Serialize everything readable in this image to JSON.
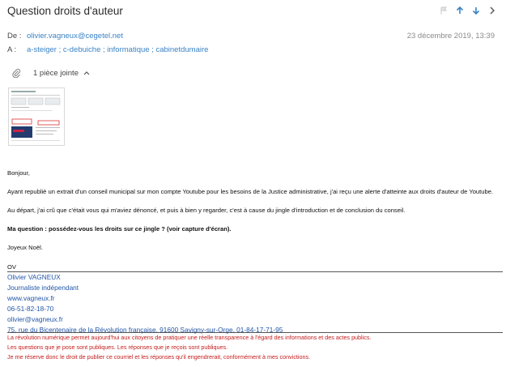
{
  "email": {
    "subject": "Question droits d'auteur",
    "from_label": "De :",
    "from": "olivier.vagneux@cegetel.net",
    "to_label": "A :",
    "to": "a-steiger ; c-debuiche ; informatique ; cabinetdumaire",
    "date": "23 décembre 2019, 13:39"
  },
  "attachments": {
    "label": "1 pièce jointe"
  },
  "body": {
    "greeting": "Bonjour,",
    "p1": "Ayant republié un extrait d'un conseil municipal sur mon compte Youtube pour les besoins de la Justice administrative, j'ai reçu une alerte d'atteinte aux droits d'auteur de Youtube.",
    "p2": "Au départ, j'ai crû que c'était vous qui m'aviez dénoncé, et puis à bien y regarder, c'est à cause du jingle d'introduction et de conclusion du conseil.",
    "question": "Ma question : possédez-vous les droits sur ce jingle ? (voir capture d'écran).",
    "closing": "Joyeux Noël.",
    "initials": "OV"
  },
  "signature": {
    "name": "Olivier VAGNEUX",
    "title": "Journaliste indépendant",
    "website": "www.vagneux.fr",
    "phone": "06-51-82-18-70",
    "email": "olivier@vagneux.fr",
    "address": "75, rue du Bicentenaire de la Révolution française, 91600 Savigny-sur-Orge, 01-84-17-71-95",
    "note1": "La révolution numérique permet aujourd'hui aux citoyens de pratiquer une réelle transparence à l'égard des informations et des actes publics.",
    "note2": "Les questions que je pose sont publiques. Les réponses que je reçois sont publiques.",
    "note3": "Je me réserve donc le droit de publier ce courriel et les réponses qu'il engendrerait, conformément à mes convictions."
  },
  "colors": {
    "link": "#3b83c4",
    "signature": "#2256a8",
    "disclaimer": "#c31b1b"
  }
}
